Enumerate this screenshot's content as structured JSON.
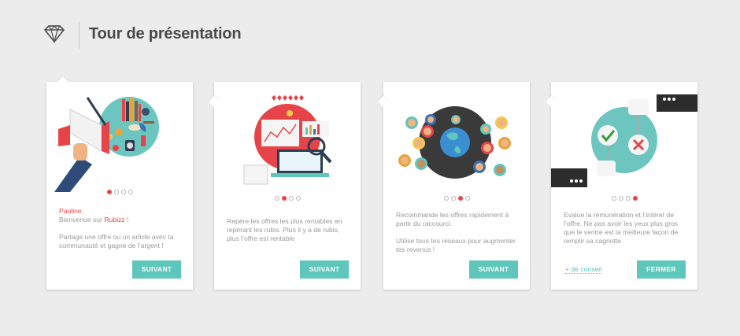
{
  "header": {
    "title": "Tour de présentation",
    "logo_icon": "diamond-icon"
  },
  "colors": {
    "accent": "#5ec6bb",
    "highlight": "#e74449",
    "text": "#999999",
    "title": "#4a4a4a"
  },
  "cards": [
    {
      "dots_active": 1,
      "greeting_name": "Pauline",
      "greeting_punct": ",",
      "welcome_prefix": "Bienvenue sur ",
      "welcome_brand": "Rubizz",
      "welcome_suffix": " !",
      "text": "Partage une offre ou un article avec ta communauté et gagne de l’argent !",
      "button": "SUIVANT",
      "illustration": "megaphone-illustration"
    },
    {
      "dots_active": 2,
      "text": "Repère les offres les plus rentables en repérant les rubis. Plus il y a de rubis, plus l’offre est rentable",
      "button": "SUIVANT",
      "illustration": "analytics-illustration"
    },
    {
      "dots_active": 3,
      "text": "Recommande les offres rapidement à partir du raccourci.",
      "text2": "Utilise tous tes réseaux pour augmenter tes revenus !",
      "button": "SUIVANT",
      "illustration": "network-globe-illustration"
    },
    {
      "dots_active": 4,
      "text": "Evalue la rémunération et l’intéret de l’offre. Ne pas avoir les yeux plus gros que le ventre est la meilleure façon de remplir sa cagnotte.",
      "link": "+ de conseil",
      "button": "FERMER",
      "illustration": "vote-illustration"
    }
  ]
}
